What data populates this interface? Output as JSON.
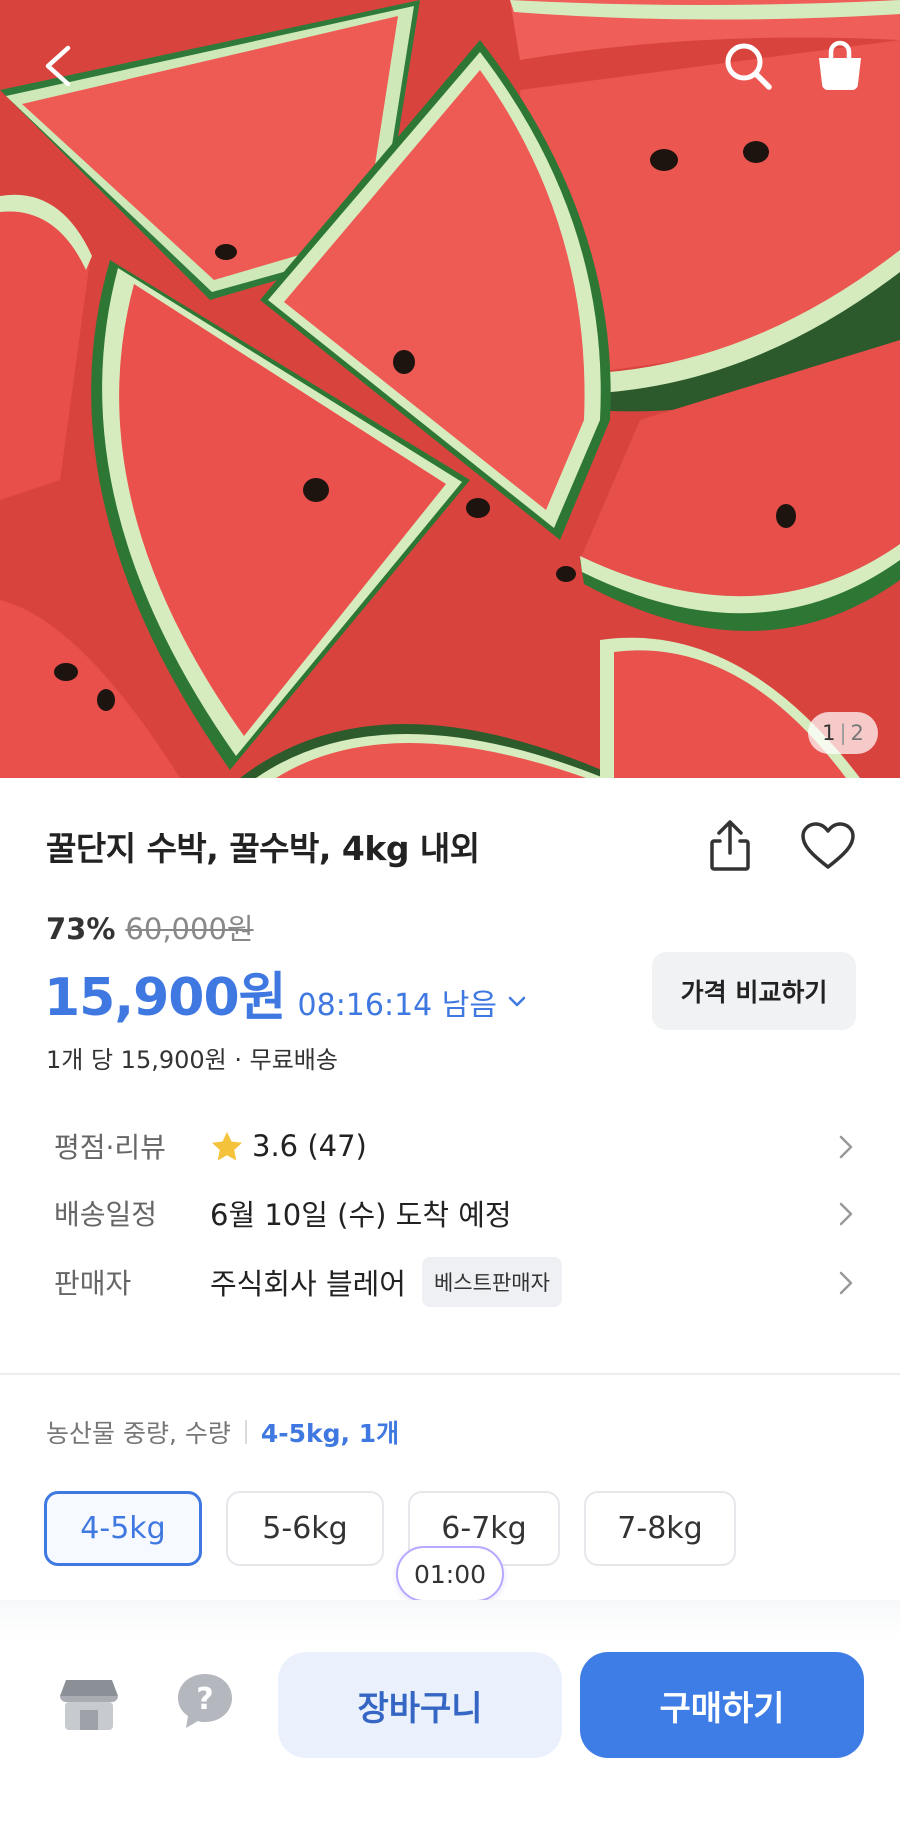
{
  "hero": {
    "image_description": "watermelon-slices",
    "counter_current": "1",
    "counter_separator": "|",
    "counter_total": "2",
    "icons": {
      "back": "chevron-left-icon",
      "search": "search-icon",
      "bag": "shopping-bag-icon"
    }
  },
  "product": {
    "title": "꿀단지 수박, 꿀수박, 4kg 내외",
    "discount": "73%",
    "original_price": "60,000원",
    "price": "15,900원",
    "time_left": "08:16:14 남음",
    "compare_label": "가격 비교하기",
    "unit_info": "1개 당 15,900원 · 무료배송"
  },
  "details": [
    {
      "label": "평점·리뷰",
      "value": "3.6 (47)",
      "icon": "star-icon"
    },
    {
      "label": "배송일정",
      "value": "6월 10일 (수) 도착 예정"
    },
    {
      "label": "판매자",
      "value": "주식회사 블레어",
      "badge": "베스트판매자"
    }
  ],
  "options": {
    "label": "농산물 중량, 수량",
    "selected_summary": "4-5kg, 1개",
    "items": [
      "4-5kg",
      "5-6kg",
      "6-7kg",
      "7-8kg"
    ],
    "selected_index": 0,
    "timer": "01:00"
  },
  "actions": {
    "cart_label": "장바구니",
    "buy_label": "구매하기"
  },
  "colors": {
    "accent": "#3f78e0",
    "buy_button": "#3f7de6",
    "cart_button_bg": "#eaf1fd",
    "star": "#f5c33b"
  }
}
